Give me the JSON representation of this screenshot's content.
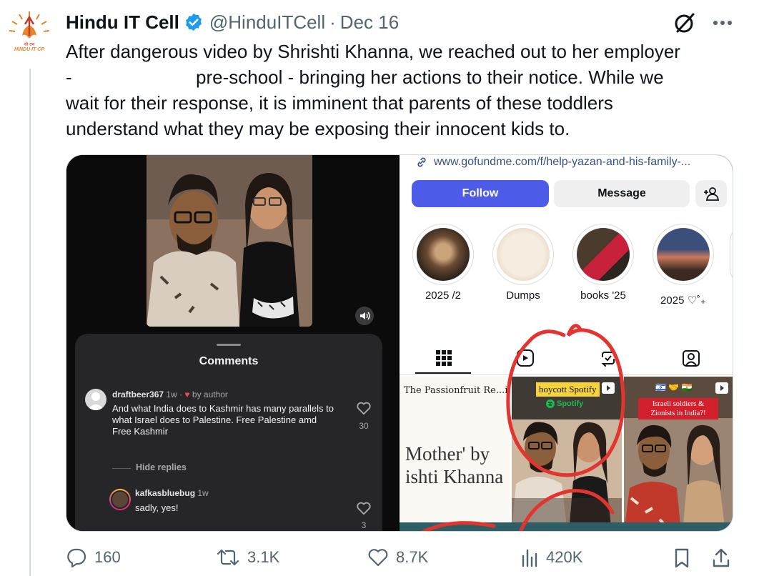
{
  "tweet": {
    "display_name": "Hindu IT Cell",
    "handle": "@HinduITCell",
    "separator": "·",
    "date": "Dec 16",
    "avatar_text": "HINDU IT CP",
    "text_lines": [
      "After dangerous video by Shrishti Khanna, we reached out to her employer",
      "-                        pre-school - bringing her actions to their notice. While we",
      "wait for their response, it is imminent that parents of these toddlers",
      "understand what they may be exposing their innocent kids to."
    ],
    "icons": [
      "verified-badge-icon",
      "grok-icon",
      "more-icon"
    ]
  },
  "media": {
    "comments_panel": {
      "title": "Comments",
      "comment1": {
        "username": "draftbeer367",
        "time": "1w",
        "separator": "·",
        "author_heart": "♥",
        "author_label": "by author",
        "text": "And what India does to Kashmir has many parallels to what Israel does to Palestine. Free Palestine amd Free Kashmir",
        "likes": "30"
      },
      "hide_replies": "Hide replies",
      "comment2": {
        "username": "kafkasbluebug",
        "time": "1w",
        "text": "sadly, yes!",
        "likes": "3"
      }
    },
    "profile_panel": {
      "link": "www.gofundme.com/f/help-yazan-and-his-family-...",
      "follow_label": "Follow",
      "message_label": "Message",
      "highlights": [
        {
          "label": "2025 /2"
        },
        {
          "label": "Dumps"
        },
        {
          "label": "books '25"
        },
        {
          "label": "2025 ♡˚₊"
        }
      ],
      "post1": {
        "line1": "The Passionfruit Re...ie",
        "line2": "Mother' by",
        "line3": "ishti Khanna"
      },
      "post2": {
        "tag": "boycott Spotify",
        "caption": "Spotify"
      },
      "post3": {
        "flags": "🇮🇱 🤝 🇮🇳",
        "tag": "Israeli soldiers & Zionists in India?!"
      }
    }
  },
  "actions": {
    "replies": "160",
    "reposts": "3.1K",
    "likes": "8.7K",
    "views": "420K"
  },
  "colors": {
    "follow_button": "#4c5ce8",
    "verified": "#1d9bf0",
    "text_secondary": "#536471",
    "annotation_red": "#e3342f"
  }
}
